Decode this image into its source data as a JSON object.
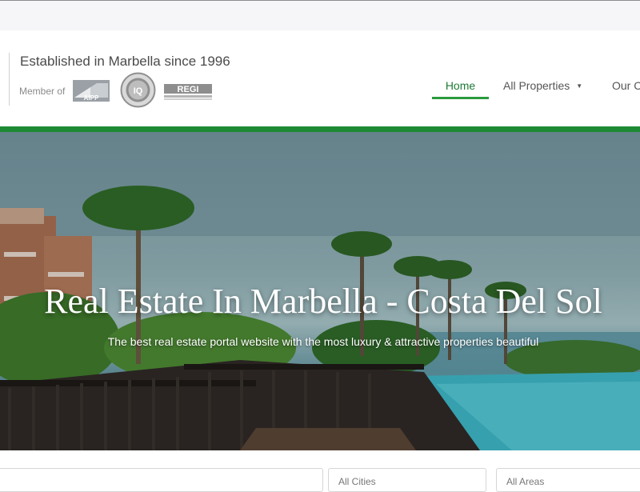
{
  "header": {
    "tagline": "Established in Marbella since 1996",
    "member_label": "Member of",
    "logos": [
      {
        "name": "aipp-logo",
        "text": "AIPP"
      },
      {
        "name": "iq-logo",
        "text": "IQ"
      },
      {
        "name": "regi-logo",
        "text": "REGI"
      }
    ]
  },
  "nav": {
    "items": [
      {
        "label": "Home",
        "active": true
      },
      {
        "label": "All Properties",
        "has_dropdown": true
      },
      {
        "label": "Our Co"
      }
    ],
    "accent_color": "#2b9a3e"
  },
  "hero": {
    "title": "Real Estate In Marbella - Costa Del Sol",
    "subtitle": "The best real estate portal website with the most luxury & attractive properties beautiful"
  },
  "search": {
    "fields": [
      {
        "placeholder": ""
      },
      {
        "placeholder": "All Cities"
      },
      {
        "placeholder": "All Areas"
      }
    ]
  },
  "colors": {
    "brand_green": "#1d8a33",
    "active_nav_text": "#1e7a34"
  }
}
